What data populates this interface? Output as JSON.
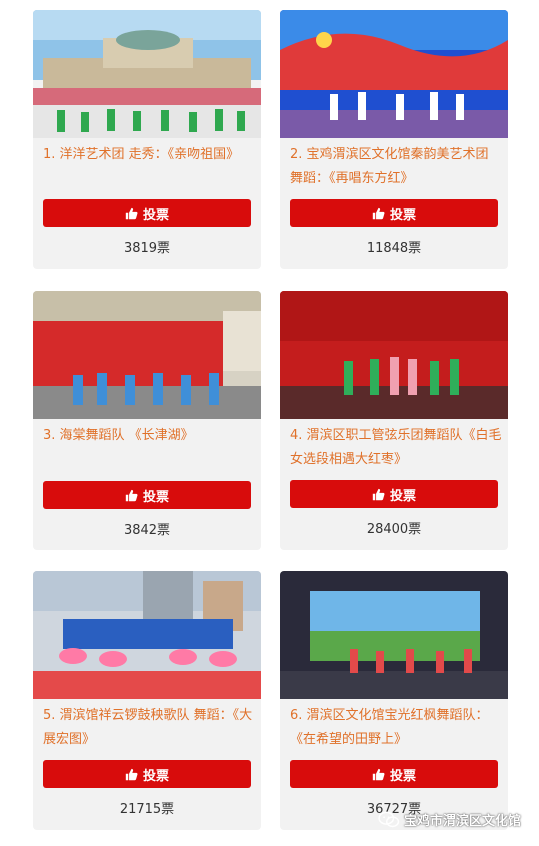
{
  "vote_label": "投票",
  "entries": [
    {
      "title": "1. 洋洋艺术团 走秀：《亲吻祖国》",
      "votes": "3819票"
    },
    {
      "title": "2. 宝鸡渭滨区文化馆秦韵美艺术团 舞蹈：《再唱东方红》",
      "votes": "11848票"
    },
    {
      "title": "3. 海棠舞蹈队 《长津湖》",
      "votes": "3842票"
    },
    {
      "title": "4. 渭滨区职工管弦乐团舞蹈队《白毛女选段相遇大红枣》",
      "votes": "28400票"
    },
    {
      "title": "5. 渭滨馆祥云锣鼓秧歌队 舞蹈：《大展宏图》",
      "votes": "21715票"
    },
    {
      "title": "6. 渭滨区文化馆宝光红枫舞蹈队：《在希望的田野上》",
      "votes": "36727票"
    }
  ],
  "watermark": {
    "text": "宝鸡市渭滨区文化馆"
  },
  "colors": {
    "accent": "#d80c0c",
    "title": "#e0712a",
    "card_bg": "#f2f2f2"
  }
}
